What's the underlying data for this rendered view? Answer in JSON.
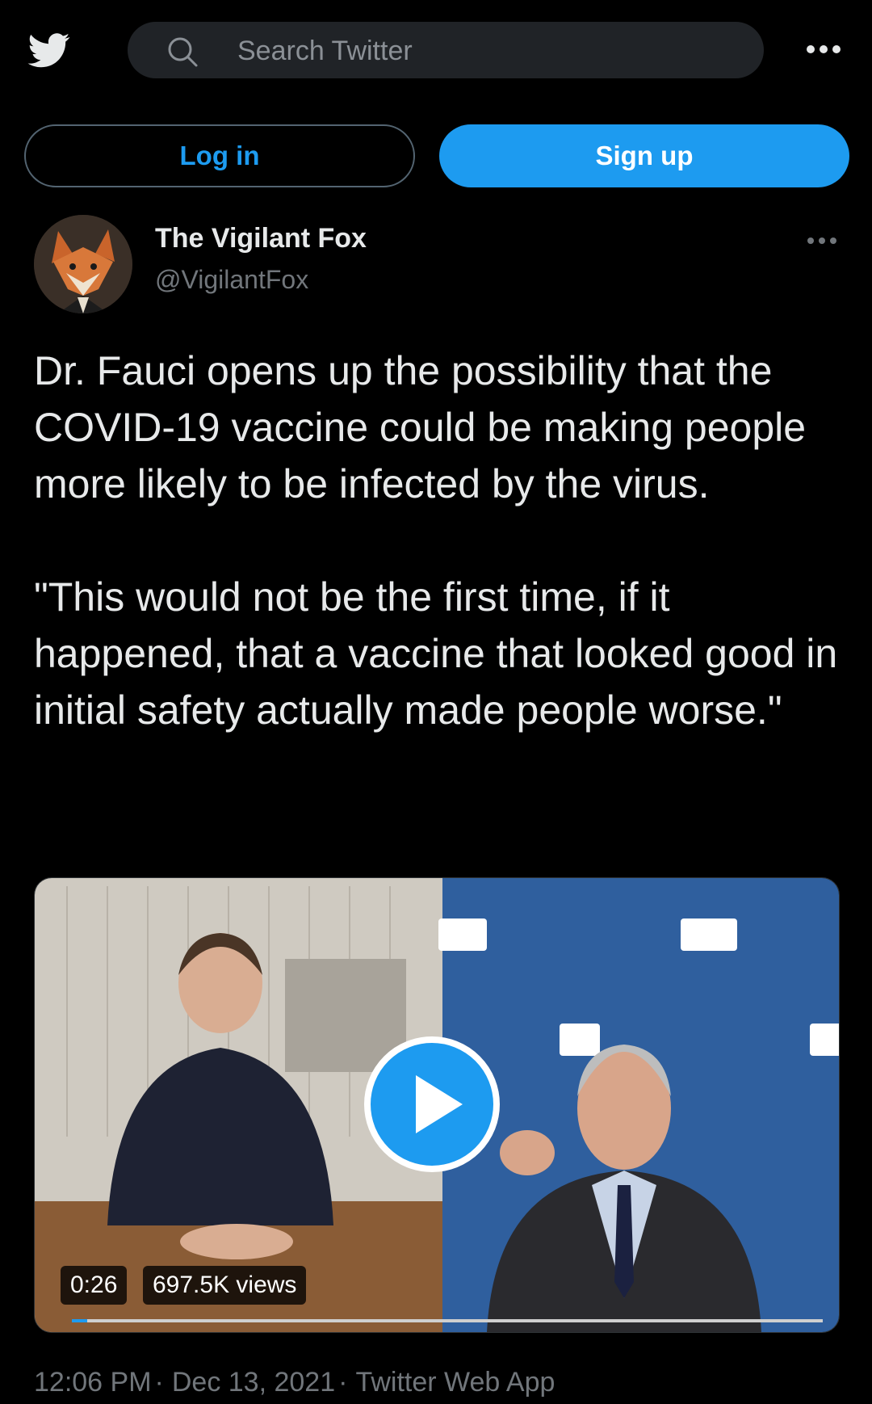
{
  "header": {
    "logo_icon": "twitter-bird-icon",
    "search_placeholder": "Search Twitter",
    "more_icon": "more-horizontal-icon"
  },
  "auth": {
    "login_label": "Log in",
    "signup_label": "Sign up"
  },
  "tweet": {
    "author_name": "The Vigilant Fox",
    "author_handle": "@VigilantFox",
    "text": "Dr. Fauci opens up the possibility that the COVID-19 vaccine could be making people more likely to be infected by the virus.\n\n\"This would not be the first time, if it happened, that a vaccine that looked good in initial safety actually made people worse.\"",
    "video": {
      "duration": "0:26",
      "views": "697.5K views",
      "play_icon": "play-icon",
      "progress_fraction": 0.02
    },
    "time": "12:06 PM",
    "date": "Dec 13, 2021",
    "source": "Twitter Web App",
    "separator": "·"
  },
  "colors": {
    "accent": "#1d9bf0",
    "background": "#000000",
    "text": "#e7e9ea",
    "muted": "#71767b"
  }
}
